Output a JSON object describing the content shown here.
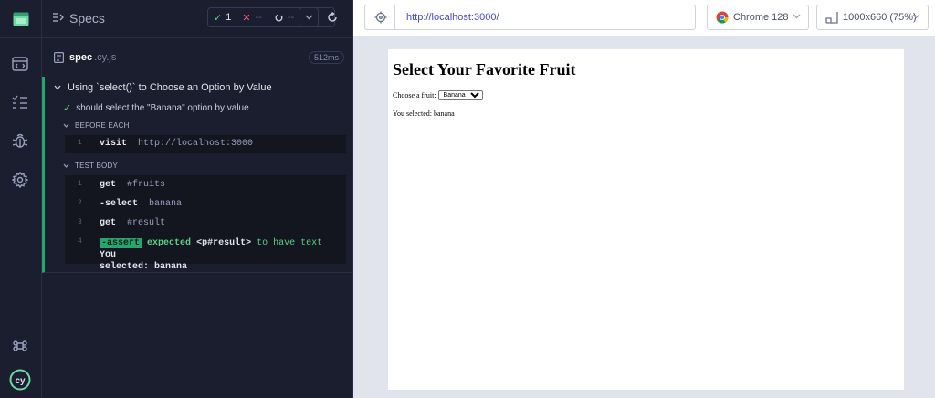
{
  "reporter": {
    "header_title": "Specs",
    "stats": {
      "passed": "1",
      "failed": "--",
      "pending": "--"
    },
    "spec": {
      "name": "spec",
      "ext": ".cy.js",
      "duration": "512ms"
    },
    "suite_title": "Using `select()` to Choose an Option by Value",
    "test_title": "should select the \"Banana\" option by value",
    "before_each_label": "BEFORE EACH",
    "test_body_label": "TEST BODY",
    "before_each_cmds": [
      {
        "num": "1",
        "name": "visit",
        "arg": "http://localhost:3000"
      }
    ],
    "test_body_cmds": [
      {
        "num": "1",
        "name": "get",
        "arg": "#fruits"
      },
      {
        "num": "2",
        "name": "-select",
        "arg": "banana"
      },
      {
        "num": "3",
        "name": "get",
        "arg": "#result"
      },
      {
        "num": "4",
        "name": "-assert",
        "msg_pre": "expected",
        "msg_el": "<p#result>",
        "msg_mid": "to have text",
        "msg_val_1": "You",
        "msg_val_2": "selected: banana"
      }
    ]
  },
  "browser": {
    "url": "http://localhost:3000/",
    "browser_name": "Chrome 128",
    "viewport": "1000x660 (75%)"
  },
  "aut": {
    "heading": "Select Your Favorite Fruit",
    "choose_label": "Choose a fruit:",
    "selected_option": "Banana",
    "result_text": "You selected: banana"
  },
  "colors": {
    "pass": "#1fa971",
    "fail": "#f05a7e",
    "url": "#3c4ad8",
    "panel_bg": "#1b1e2e"
  },
  "icons": [
    "app-logo-icon",
    "specs-list-icon",
    "runs-icon",
    "debug-icon",
    "settings-icon",
    "keyboard-shortcuts-icon",
    "cypress-logo-icon",
    "crosshair-icon",
    "chrome-icon",
    "viewport-icon",
    "chevron-down-icon",
    "reload-icon",
    "file-icon",
    "check-icon"
  ]
}
